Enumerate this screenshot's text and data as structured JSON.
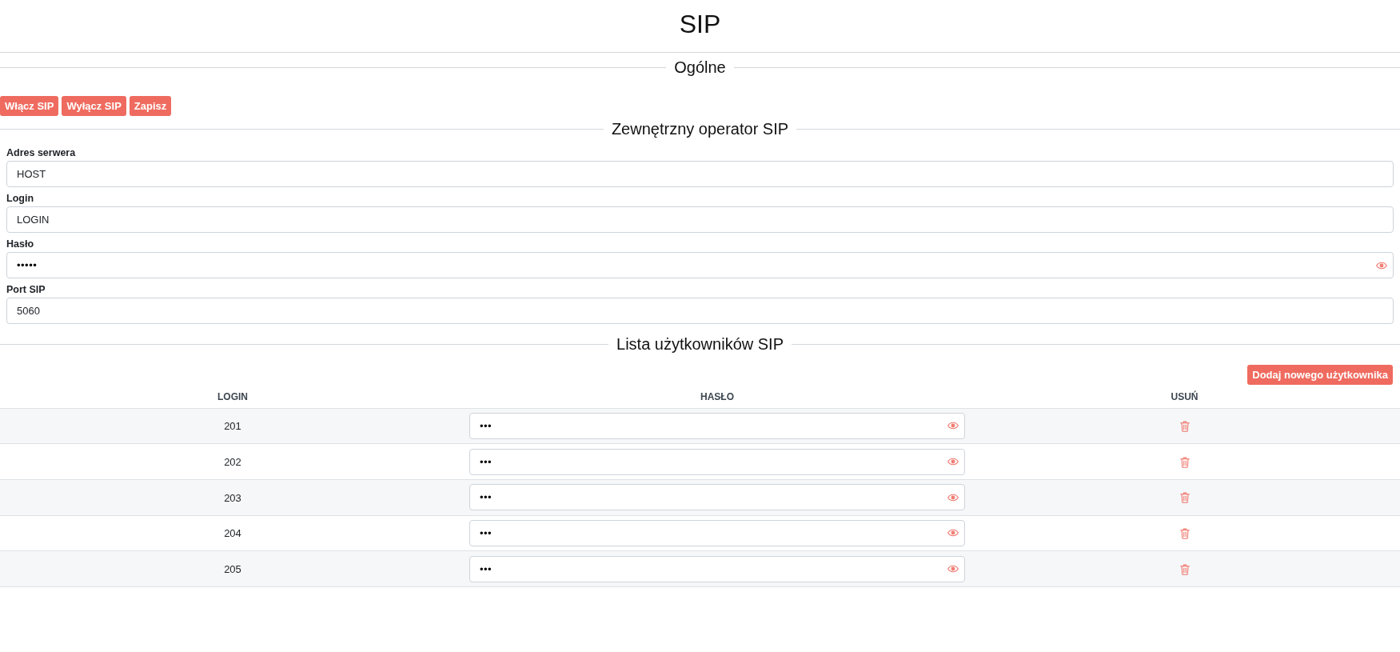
{
  "page": {
    "title": "SIP"
  },
  "general": {
    "heading": "Ogólne",
    "buttons": [
      "Włącz SIP",
      "Wyłącz SIP",
      "Zapisz"
    ]
  },
  "external_operator": {
    "heading": "Zewnętrzny operator SIP",
    "fields": [
      {
        "label": "Adres serwera",
        "value": "HOST",
        "kind": "text"
      },
      {
        "label": "Login",
        "value": "LOGIN",
        "kind": "text"
      },
      {
        "label": "Hasło",
        "value": "•••••",
        "kind": "password"
      },
      {
        "label": "Port SIP",
        "value": "5060",
        "kind": "text"
      }
    ]
  },
  "users": {
    "heading": "Lista użytkowników SIP",
    "add_button": "Dodaj nowego użytkownika",
    "columns": [
      "LOGIN",
      "HASŁO",
      "USUŃ"
    ],
    "rows": [
      {
        "login": "201",
        "password": "•••"
      },
      {
        "login": "202",
        "password": "•••"
      },
      {
        "login": "203",
        "password": "•••"
      },
      {
        "login": "204",
        "password": "•••"
      },
      {
        "login": "205",
        "password": "•••"
      }
    ]
  }
}
